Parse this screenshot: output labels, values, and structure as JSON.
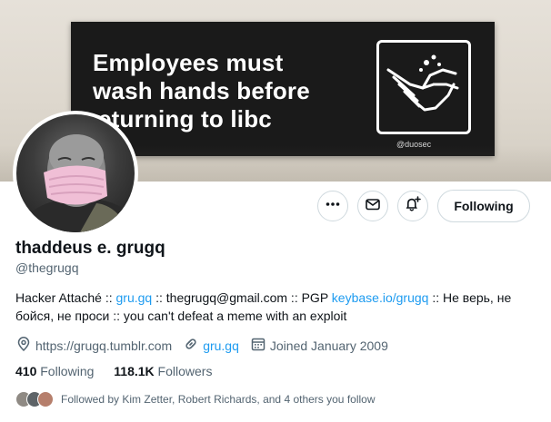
{
  "banner": {
    "line1": "Employees must",
    "line2": "wash hands before",
    "line3": "eturning to libc",
    "credit": "@duosec"
  },
  "icons": {
    "more": "more-icon",
    "message": "envelope-icon",
    "notify": "bell-plus-icon",
    "location": "location-pin-icon",
    "link": "link-icon",
    "calendar": "calendar-icon"
  },
  "actions": {
    "following_label": "Following"
  },
  "profile": {
    "name": "thaddeus e. grugq",
    "handle": "@thegrugq",
    "bio": {
      "p1": "Hacker Attaché :: ",
      "link1": "gru.gq",
      "p2": " :: thegrugq@gmail.com :: PGP ",
      "link2": "keybase.io/grugq",
      "p3": " :: Не верь, не бойся, не проси :: you can't defeat a meme with an exploit"
    },
    "location": "https://grugq.tumblr.com",
    "website": "gru.gq",
    "joined": "Joined January 2009"
  },
  "stats": {
    "following_count": "410",
    "following_label": "Following",
    "followers_count": "118.1K",
    "followers_label": "Followers"
  },
  "followed_by": "Followed by Kim Zetter, Robert Richards, and 4 others you follow",
  "colors": {
    "accent": "#1d9bf0",
    "text": "#0f1419",
    "muted": "#536471",
    "border": "#cfd9de"
  }
}
